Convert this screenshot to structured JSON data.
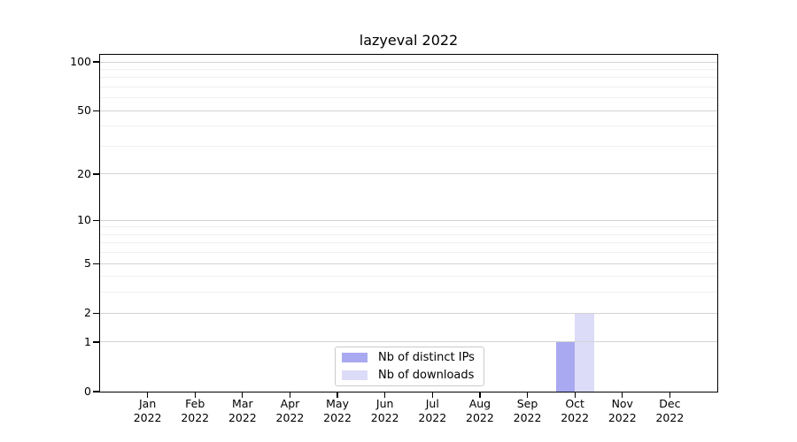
{
  "title": "lazyeval 2022",
  "chart_data": {
    "type": "bar",
    "title": "lazyeval 2022",
    "categories": [
      "Jan 2022",
      "Feb 2022",
      "Mar 2022",
      "Apr 2022",
      "May 2022",
      "Jun 2022",
      "Jul 2022",
      "Aug 2022",
      "Sep 2022",
      "Oct 2022",
      "Nov 2022",
      "Dec 2022"
    ],
    "series": [
      {
        "name": "Nb of distinct IPs",
        "color": "#a9a9f1",
        "values": [
          0,
          0,
          0,
          0,
          0,
          0,
          0,
          0,
          0,
          1,
          0,
          0
        ]
      },
      {
        "name": "Nb of downloads",
        "color": "#dcdcf8",
        "values": [
          0,
          0,
          0,
          0,
          0,
          0,
          0,
          0,
          0,
          2,
          0,
          0
        ]
      }
    ],
    "xlabel": "",
    "ylabel": "",
    "yscale": "log1p",
    "ylim": [
      0,
      110
    ],
    "y_ticks": [
      0,
      1,
      2,
      5,
      10,
      20,
      50,
      100
    ],
    "y_minor_ticks": [
      3,
      4,
      6,
      7,
      8,
      9,
      30,
      40,
      60,
      70,
      80,
      90
    ],
    "grid": "horizontal",
    "legend_position": "lower center",
    "colors": {
      "grid_major": "#d3d3d3",
      "grid_minor": "#f0f0f0",
      "spine": "#000000",
      "background": "#ffffff"
    }
  }
}
